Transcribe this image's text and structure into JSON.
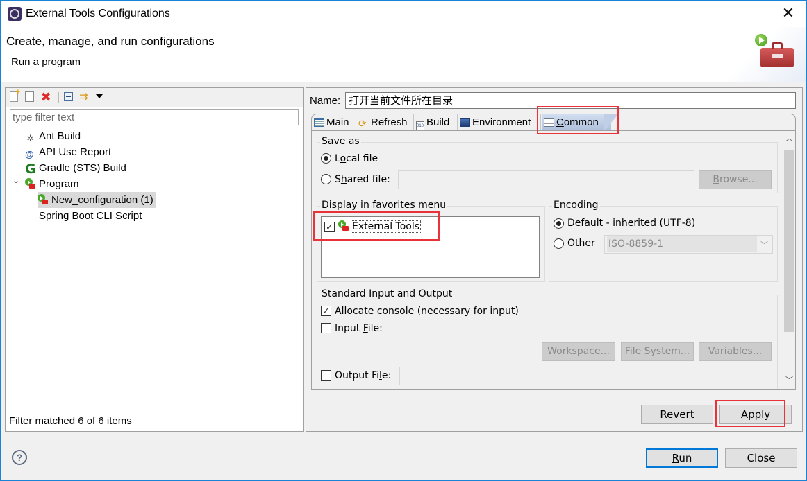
{
  "window": {
    "title": "External Tools Configurations",
    "close_glyph": "✕"
  },
  "header": {
    "title": "Create, manage, and run configurations",
    "subtitle": "Run a program"
  },
  "left": {
    "toolbar": {
      "icons": [
        "new-configuration-icon",
        "duplicate-icon",
        "delete-icon",
        "collapse-all-icon",
        "filter-icon",
        "view-menu-icon"
      ],
      "delete_glyph": "✖",
      "filter_glyph": "⇉"
    },
    "filter_placeholder": "type filter text",
    "tree": [
      {
        "label": "Ant Build",
        "icon": "ant-icon",
        "glyph": "✲",
        "level": 1
      },
      {
        "label": "API Use Report",
        "icon": "api-report-icon",
        "glyph": "@",
        "level": 1
      },
      {
        "label": "Gradle (STS) Build",
        "icon": "gradle-icon",
        "glyph": "G",
        "level": 1
      },
      {
        "label": "Program",
        "icon": "program-icon",
        "level": 1,
        "expanded": true,
        "chevron": "⌄"
      },
      {
        "label": "New_configuration (1)",
        "icon": "program-icon",
        "level": 2,
        "selected": true
      },
      {
        "label": "Spring Boot CLI Script",
        "icon": "",
        "level": 2
      }
    ],
    "status": "Filter matched 6 of 6 items"
  },
  "right": {
    "name_label_u": "N",
    "name_label_rest": "ame:",
    "name_value": "打开当前文件所在目录",
    "tabs": [
      {
        "label": "Main",
        "icon": "main-tab-icon",
        "active": false
      },
      {
        "label": "Refresh",
        "icon": "refresh-icon",
        "active": false,
        "glyph": "⟳"
      },
      {
        "label": "Build",
        "icon": "build-icon",
        "active": false,
        "glyph": "010"
      },
      {
        "label": "Environment",
        "icon": "environment-icon",
        "active": false
      },
      {
        "label_u": "C",
        "label_rest": "ommon",
        "icon": "common-tab-icon",
        "active": true
      }
    ],
    "save_as": {
      "legend": "Save as",
      "local_u_pre": "L",
      "local_u": "o",
      "local_rest": "cal file",
      "local_selected": true,
      "shared_pre": "S",
      "shared_u": "h",
      "shared_rest": "ared file:",
      "shared_value": "",
      "browse_u": "B",
      "browse_rest": "rowse..."
    },
    "favorites": {
      "legend": "Display in favorites menu",
      "items": [
        {
          "label": "External Tools",
          "checked": true,
          "check_glyph": "✓"
        }
      ]
    },
    "encoding": {
      "legend": "Encoding",
      "default_pre": "Defa",
      "default_u": "u",
      "default_rest": "lt - inherited (UTF-8)",
      "default_selected": true,
      "other_pre": "Oth",
      "other_u": "e",
      "other_rest": "r",
      "other_value": "ISO-8859-1",
      "arrow": "﹀"
    },
    "std_io": {
      "legend": "Standard Input and Output",
      "allocate_u": "A",
      "allocate_rest": "llocate console (necessary for input)",
      "allocate_checked": true,
      "check_glyph": "✓",
      "input_pre": "Input ",
      "input_u": "F",
      "input_rest": "ile:",
      "input_checked": false,
      "workspace": "Workspace...",
      "file_system": "File System...",
      "variables": "Variables...",
      "output_pre": "Output Fi",
      "output_u": "l",
      "output_rest": "e:",
      "output_checked": false
    },
    "scroll": {
      "up": "︿",
      "down": "﹀"
    },
    "revert_pre": "Re",
    "revert_u": "v",
    "revert_rest": "ert",
    "apply_pre": "Appl",
    "apply_u": "y"
  },
  "footer": {
    "help_glyph": "?",
    "run_u": "R",
    "run_rest": "un",
    "close": "Close"
  }
}
